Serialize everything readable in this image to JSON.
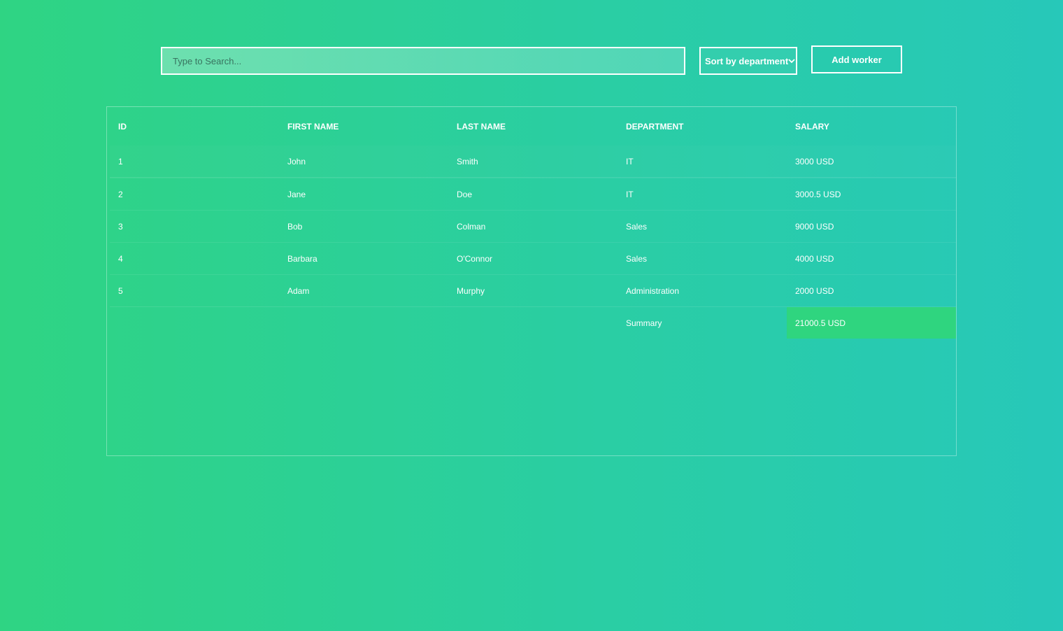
{
  "toolbar": {
    "search_placeholder": "Type to Search...",
    "search_value": "",
    "sort_label": "Sort by department",
    "add_label": "Add worker"
  },
  "table": {
    "headers": [
      "ID",
      "FIRST NAME",
      "LAST NAME",
      "DEPARTMENT",
      "SALARY"
    ],
    "rows": [
      [
        "1",
        "John",
        "Smith",
        "IT",
        "3000 USD"
      ],
      [
        "2",
        "Jane",
        "Doe",
        "IT",
        "3000.5 USD"
      ],
      [
        "3",
        "Bob",
        "Colman",
        "Sales",
        "9000 USD"
      ],
      [
        "4",
        "Barbara",
        "O'Connor",
        "Sales",
        "4000 USD"
      ],
      [
        "5",
        "Adam",
        "Murphy",
        "Administration",
        "2000 USD"
      ]
    ],
    "summary": {
      "label": "Summary",
      "total": "21000.5 USD"
    }
  },
  "colors": {
    "gradient_start": "#2fd483",
    "gradient_end": "#27c8b9",
    "summary_highlight": "#2fd57f",
    "text": "#ffffff"
  }
}
